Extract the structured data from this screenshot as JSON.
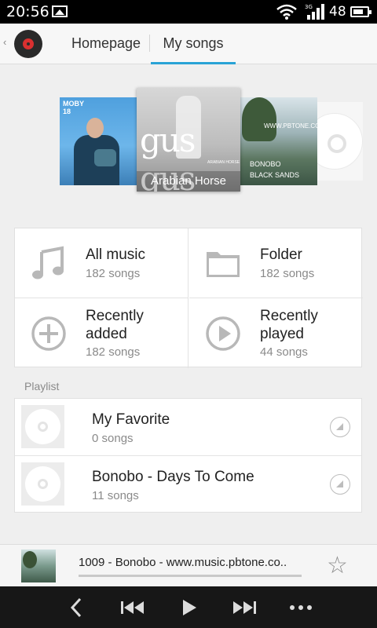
{
  "status_bar": {
    "time": "20:56",
    "network": "3G",
    "battery": "48",
    "icons": [
      "picture-icon",
      "wifi-icon",
      "signal-icon",
      "battery-icon"
    ]
  },
  "header": {
    "tabs": [
      {
        "label": "Homepage",
        "active": false
      },
      {
        "label": "My songs",
        "active": true
      }
    ],
    "accent_color": "#29a3d6"
  },
  "carousel": {
    "albums": [
      {
        "text": "MOBY 18",
        "artist": "MOBY",
        "title": "18"
      },
      {
        "caption": "Arabian Horse",
        "logo_text": "gus gus",
        "sub_text": "ARABIAN HORSE"
      },
      {
        "site_text": "WWW.PBTONE.COM",
        "band": "BONOBO",
        "album": "BLACK SANDS"
      },
      {
        "placeholder": "disc"
      }
    ]
  },
  "library": {
    "items": [
      {
        "title": "All music",
        "count": "182 songs",
        "icon": "music-note-icon"
      },
      {
        "title": "Folder",
        "count": "182 songs",
        "icon": "folder-icon"
      },
      {
        "title": "Recently added",
        "count": "182 songs",
        "icon": "plus-circle-icon"
      },
      {
        "title": "Recently played",
        "count": "44 songs",
        "icon": "play-circle-icon"
      }
    ]
  },
  "playlist": {
    "header": "Playlist",
    "items": [
      {
        "name": "My Favorite",
        "count": "0 songs"
      },
      {
        "name": "Bonobo - Days To Come",
        "count": "11 songs"
      }
    ]
  },
  "now_playing": {
    "title": "1009 - Bonobo - www.music.pbtone.co..",
    "progress": 0
  },
  "controls": {
    "icons": [
      "back-icon",
      "previous-icon",
      "play-icon",
      "next-icon",
      "more-icon"
    ]
  }
}
